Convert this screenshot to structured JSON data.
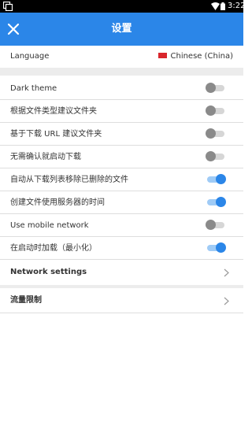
{
  "status_bar": {
    "time": "3:22"
  },
  "app_bar": {
    "title": "设置"
  },
  "language": {
    "label": "Language",
    "value": "Chinese (China)"
  },
  "toggles": [
    {
      "label": "Dark theme",
      "on": false
    },
    {
      "label": "根据文件类型建议文件夹",
      "on": false
    },
    {
      "label": "基于下载 URL 建议文件夹",
      "on": false
    },
    {
      "label": "无需确认就启动下载",
      "on": false
    },
    {
      "label": "自动从下载列表移除已删除的文件",
      "on": true
    },
    {
      "label": "创建文件使用服务器的时间",
      "on": true
    },
    {
      "label": "Use mobile network",
      "on": false
    },
    {
      "label": "在启动时加载（最小化）",
      "on": true
    }
  ],
  "links": [
    {
      "label": "Network settings"
    },
    {
      "label": "流量限制"
    }
  ],
  "colors": {
    "primary": "#2b86e8",
    "track_on": "#9fcbf6",
    "divider": "#dedede"
  }
}
